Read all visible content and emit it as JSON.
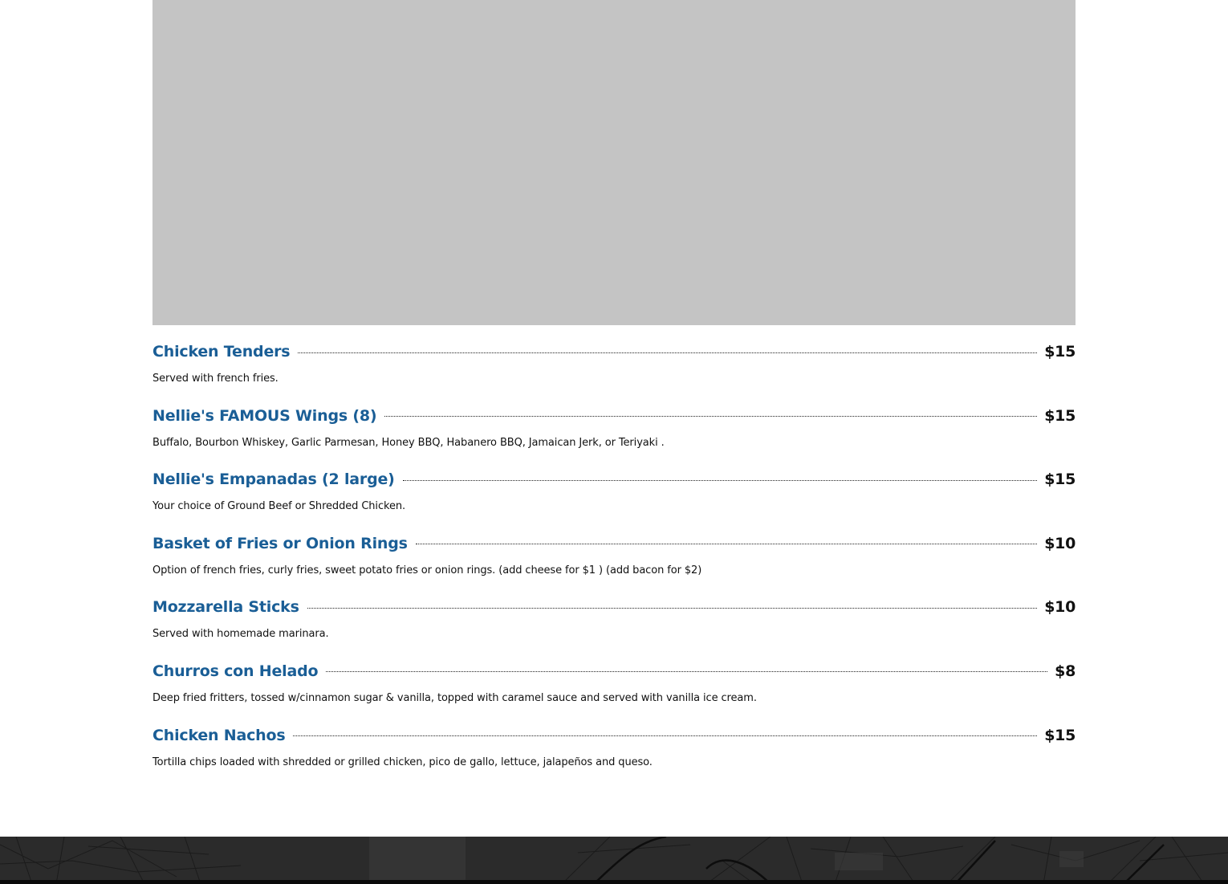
{
  "menu": {
    "items": [
      {
        "name": "Chicken Tenders",
        "price": "$15",
        "description": "Served with french fries."
      },
      {
        "name": "Nellie's FAMOUS Wings (8)",
        "price": "$15",
        "description": "Buffalo, Bourbon Whiskey, Garlic Parmesan, Honey BBQ, Habanero BBQ, Jamaican Jerk, or Teriyaki ."
      },
      {
        "name": "Nellie's Empanadas (2 large)",
        "price": "$15",
        "description": "Your choice of Ground Beef or Shredded Chicken."
      },
      {
        "name": "Basket of Fries or Onion Rings",
        "price": "$10",
        "description": "Option of french fries, curly fries, sweet potato fries or onion rings. (add cheese for $1 ) (add bacon for $2)"
      },
      {
        "name": "Mozzarella Sticks",
        "price": "$10",
        "description": "Served with homemade marinara."
      },
      {
        "name": "Churros con Helado",
        "price": "$8",
        "description": "Deep fried fritters, tossed w/cinnamon sugar & vanilla, topped with caramel sauce and served with vanilla ice cream."
      },
      {
        "name": "Chicken Nachos",
        "price": "$15",
        "description": "Tortilla chips loaded with shredded or grilled chicken, pico de gallo, lettuce, jalapeños and queso."
      }
    ]
  },
  "colors": {
    "item_name": "#1a5e96",
    "price": "#111111",
    "image_placeholder": "#c4c4c4",
    "footer": "#2b2b2b"
  }
}
